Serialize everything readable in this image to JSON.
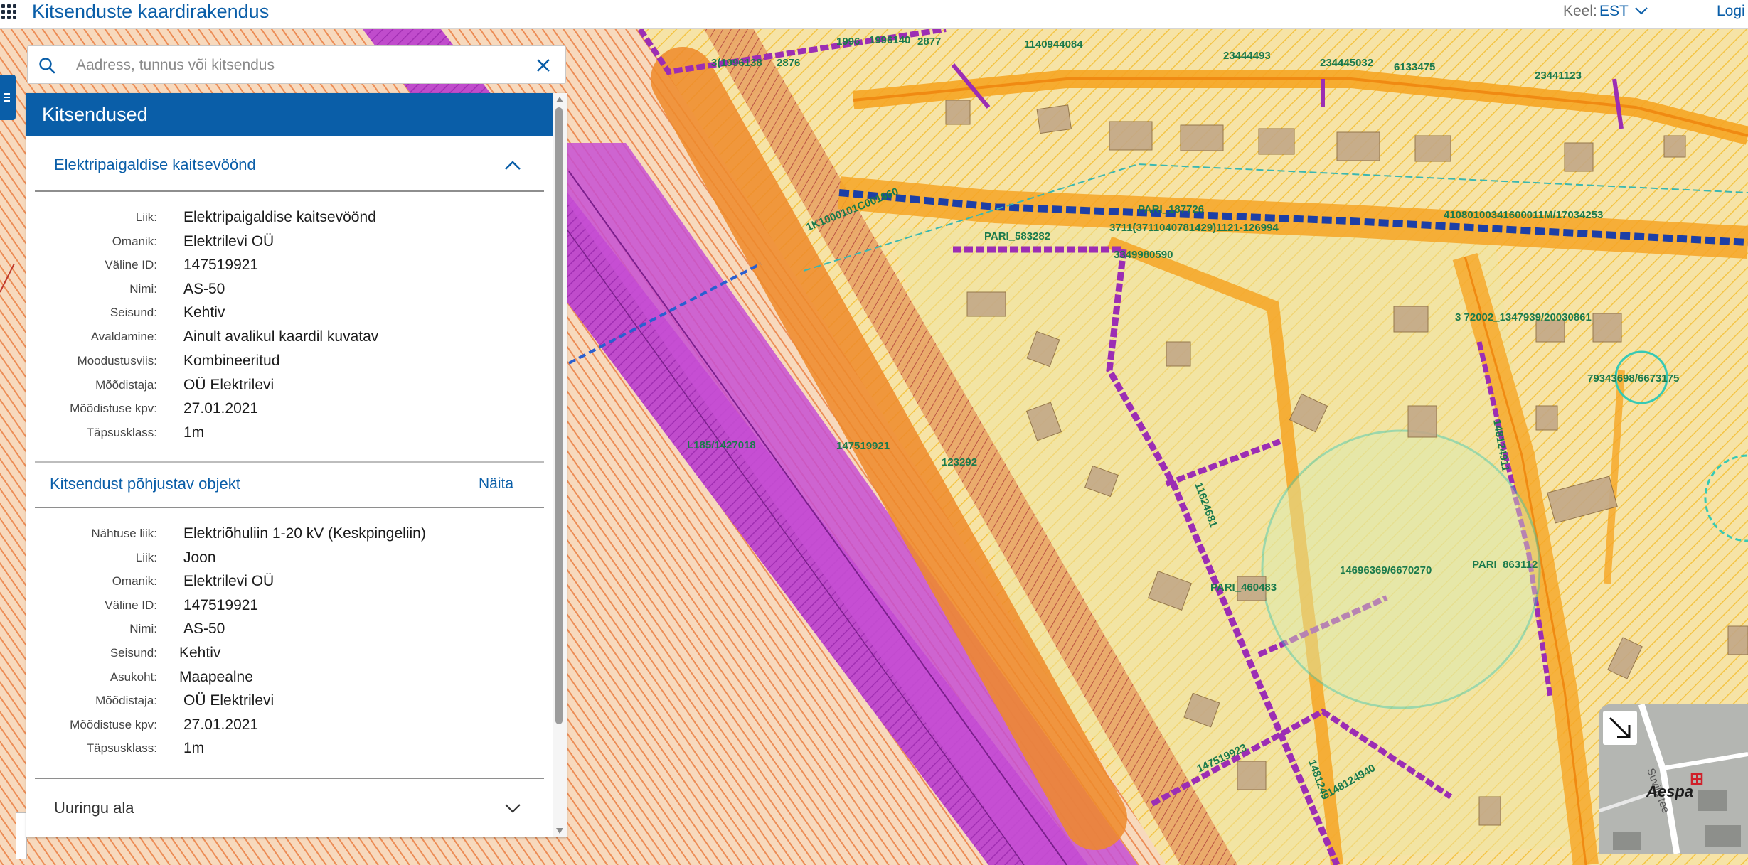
{
  "header": {
    "title": "Kitsenduste kaardirakendus",
    "language_label": "Keel:",
    "language_value": "EST",
    "login_label": "Logi"
  },
  "search": {
    "placeholder": "Aadress, tunnus või kitsendus"
  },
  "panel": {
    "title": "Kitsendused",
    "restriction": {
      "title": "Elektripaigaldise kaitsevöönd",
      "fields": [
        {
          "label": "Liik:",
          "value": "Elektripaigaldise kaitsevöönd"
        },
        {
          "label": "Omanik:",
          "value": "Elektrilevi OÜ"
        },
        {
          "label": "Väline ID:",
          "value": "147519921"
        },
        {
          "label": "Nimi:",
          "value": "AS-50"
        },
        {
          "label": "Seisund:",
          "value": "Kehtiv"
        },
        {
          "label": "Avaldamine:",
          "value": "Ainult avalikul kaardil kuvatav"
        },
        {
          "label": "Moodustusviis:",
          "value": "Kombineeritud"
        },
        {
          "label": "Mõõdistaja:",
          "value": "OÜ Elektrilevi"
        },
        {
          "label": "Mõõdistuse kpv:",
          "value": "27.01.2021"
        },
        {
          "label": "Täpsusklass:",
          "value": "1m"
        }
      ]
    },
    "cause_object": {
      "title": "Kitsendust põhjustav objekt",
      "show_label": "Näita",
      "fields": [
        {
          "label": "Nähtuse liik:",
          "value": "Elektriõhuliin 1-20 kV (Keskpingeliin)"
        },
        {
          "label": "Liik:",
          "value": "Joon"
        },
        {
          "label": "Omanik:",
          "value": "Elektrilevi OÜ"
        },
        {
          "label": "Väline ID:",
          "value": "147519921"
        },
        {
          "label": "Nimi:",
          "value": "AS-50"
        },
        {
          "label": "Seisund:",
          "value": "Kehtiv"
        },
        {
          "label": "Asukoht:",
          "value": "Maapealne"
        },
        {
          "label": "Mõõdistaja:",
          "value": "OÜ Elektrilevi"
        },
        {
          "label": "Mõõdistuse kpv:",
          "value": "27.01.2021"
        },
        {
          "label": "Täpsusklass:",
          "value": "1m"
        }
      ]
    },
    "collapsed_section": {
      "title": "Uuringu ala"
    }
  },
  "map": {
    "labels": {
      "l1": "1996",
      "l2": "1996140",
      "l3": "2877",
      "l4": "23444493",
      "l5": "234445032",
      "l6": "6133475",
      "l7": "23441123",
      "l8": "1140944084",
      "l9": "3(1996138",
      "l10": "2876",
      "l11": "PARI_187726",
      "l12": "PARI_583282",
      "l13": "3711(3711040781429)1121-126994",
      "l14": "3349980590",
      "l15": "1K1000101C001960",
      "l16": "41080100341600011M/17034253",
      "l17": "3 72002_1347939/20030861",
      "l18": "79343698/6673175",
      "l19": "L185/1427018",
      "l20": "147519921",
      "l21": "123292",
      "l22": "14696369/6670270",
      "l23": "PARI_863112",
      "l24": "PARI_460483",
      "l25": "147519923",
      "l26": "148124940",
      "l27": "11624681",
      "l28": "148124911",
      "l29": "1481249"
    },
    "overview_place": "Aespa",
    "overview_road": "Suvila tee"
  },
  "colors": {
    "brand_blue": "#0a5ea8",
    "protection_zone": "#f39a3b",
    "purple_zone": "#b23cc1",
    "parcel_outline": "#ffc125"
  }
}
